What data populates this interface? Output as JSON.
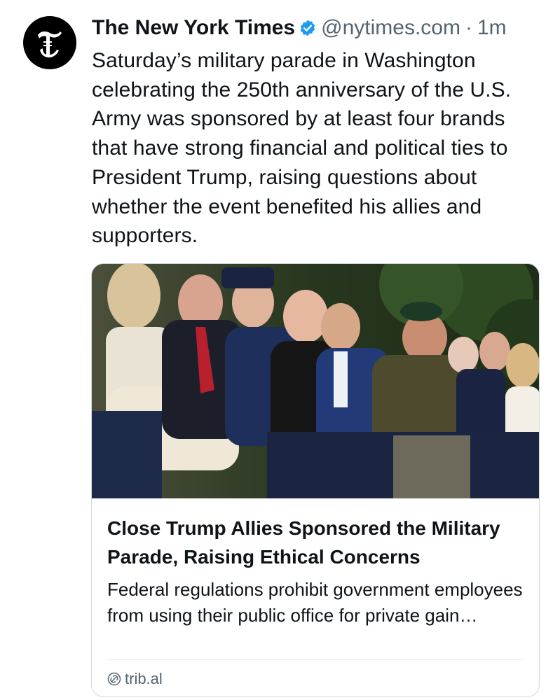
{
  "post": {
    "author": {
      "display_name": "The New York Times",
      "handle": "@nytimes.com",
      "verified": true,
      "avatar_icon": "nyt-t-logo-icon"
    },
    "separator": "·",
    "timestamp": "1m",
    "text": "Saturday’s military parade in Washington celebrating the 250th anniversary of the U.S. Army was sponsored by at least four brands that have strong financial and political ties to President Trump, raising questions about whether the event benefited his allies and supporters."
  },
  "link_card": {
    "image_icon": "parade-audience-photo",
    "title": "Close Trump Allies Sponsored the Military Parade, Raising Ethical Concerns",
    "description": "Federal regulations prohibit government employees from using their public office for private gain…",
    "domain": "trib.al",
    "domain_icon": "link-globe-icon"
  },
  "colors": {
    "text_primary": "#0f1419",
    "text_secondary": "#536471",
    "verified_badge": "#1d9bf0",
    "card_border": "#cfd9de"
  }
}
